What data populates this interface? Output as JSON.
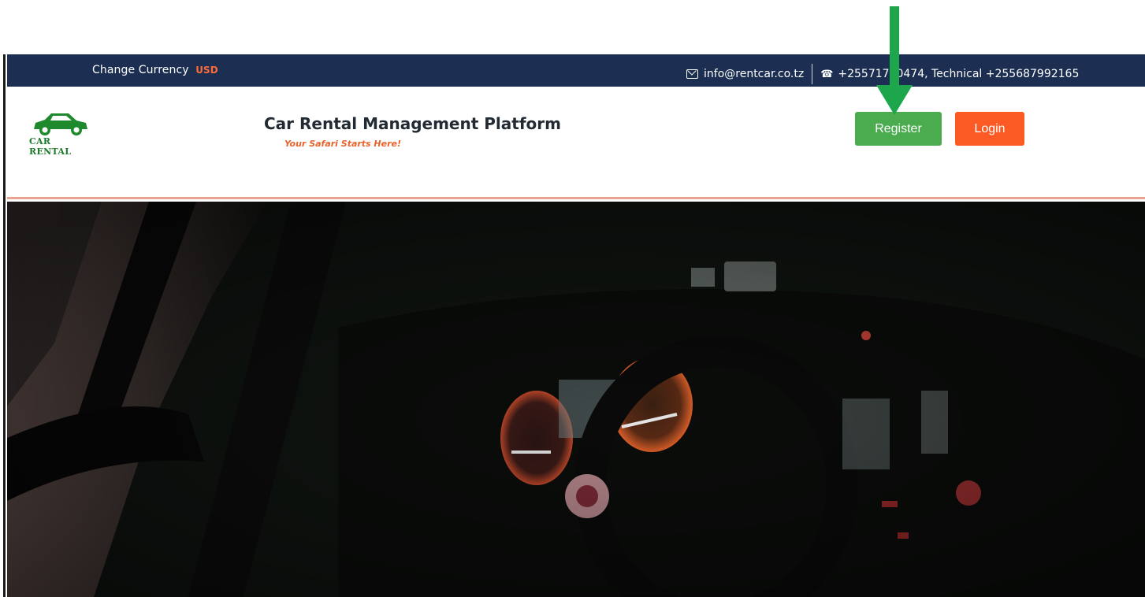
{
  "topbar": {
    "currency_label": "Change Currency",
    "currency_code": "USD",
    "email": "info@rentcar.co.tz",
    "phone": "+25571750474, Technical +255687992165"
  },
  "header": {
    "logo_text": "CAR RENTAL",
    "title": "Car Rental Management Platform",
    "tagline": "Your Safari Starts Here!",
    "register_label": "Register",
    "login_label": "Login"
  },
  "icons": {
    "email": "mail-icon",
    "phone": "phone-icon",
    "logo": "car-logo-icon",
    "annotation": "arrow-down-icon"
  },
  "colors": {
    "topbar_bg": "#1c2f52",
    "currency_accent": "#ff6a3a",
    "register": "#4bab4f",
    "login": "#fb5a24",
    "tagline": "#e8632b",
    "logo_green": "#1b7a2a",
    "annotation_arrow": "#1ea64d"
  }
}
